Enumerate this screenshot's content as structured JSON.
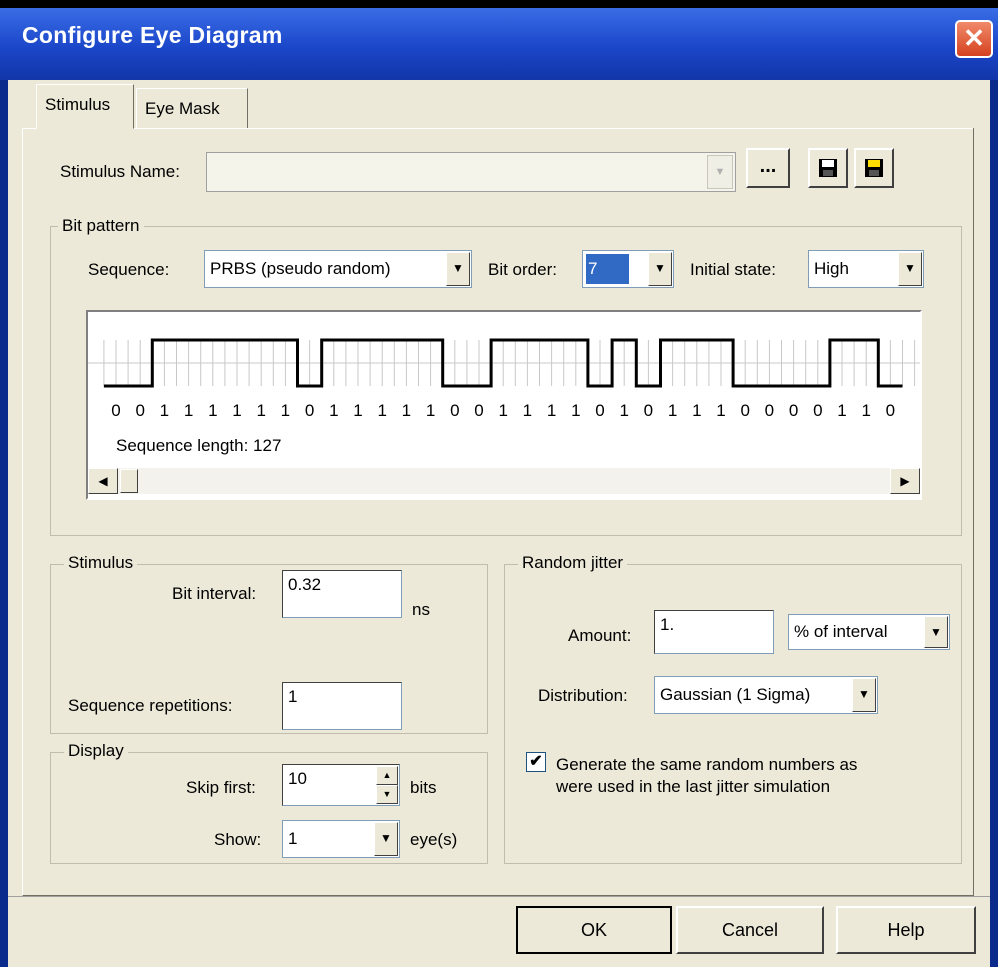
{
  "window": {
    "title": "Configure Eye Diagram",
    "close_glyph": "✕"
  },
  "tabs": [
    {
      "label": "Stimulus",
      "active": true
    },
    {
      "label": "Eye Mask",
      "active": false
    }
  ],
  "stimulus_name": {
    "label": "Stimulus Name:",
    "value": "",
    "browse_label": "...",
    "save_icon": "floppy-disk-icon",
    "save_as_icon": "floppy-disk-new-icon"
  },
  "bit_pattern": {
    "group_label": "Bit pattern",
    "sequence_label": "Sequence:",
    "sequence_value": "PRBS (pseudo random)",
    "bit_order_label": "Bit order:",
    "bit_order_value": "7",
    "initial_state_label": "Initial state:",
    "initial_state_value": "High",
    "bits": [
      0,
      0,
      1,
      1,
      1,
      1,
      1,
      1,
      0,
      1,
      1,
      1,
      1,
      1,
      0,
      0,
      1,
      1,
      1,
      1,
      0,
      1,
      0,
      1,
      1,
      1,
      0,
      0,
      0,
      0,
      1,
      1,
      0
    ],
    "sequence_length_text": "Sequence length: 127",
    "signal_color": "#000000",
    "grid_color": "#c8c8c8"
  },
  "stimulus": {
    "group_label": "Stimulus",
    "bit_interval_label": "Bit interval:",
    "bit_interval_value": "0.32",
    "bit_interval_unit": "ns",
    "repetitions_label": "Sequence repetitions:",
    "repetitions_value": "1"
  },
  "display": {
    "group_label": "Display",
    "skip_first_label": "Skip first:",
    "skip_first_value": "10",
    "skip_first_unit": "bits",
    "show_label": "Show:",
    "show_value": "1",
    "show_unit": "eye(s)"
  },
  "random_jitter": {
    "group_label": "Random jitter",
    "amount_label": "Amount:",
    "amount_value": "1.",
    "amount_unit_value": "% of interval",
    "distribution_label": "Distribution:",
    "distribution_value": "Gaussian (1 Sigma)",
    "same_random_checked": true,
    "same_random_label_line1": "Generate the same random numbers as",
    "same_random_label_line2": "were used in the last jitter simulation"
  },
  "buttons": {
    "ok": "OK",
    "cancel": "Cancel",
    "help": "Help"
  }
}
